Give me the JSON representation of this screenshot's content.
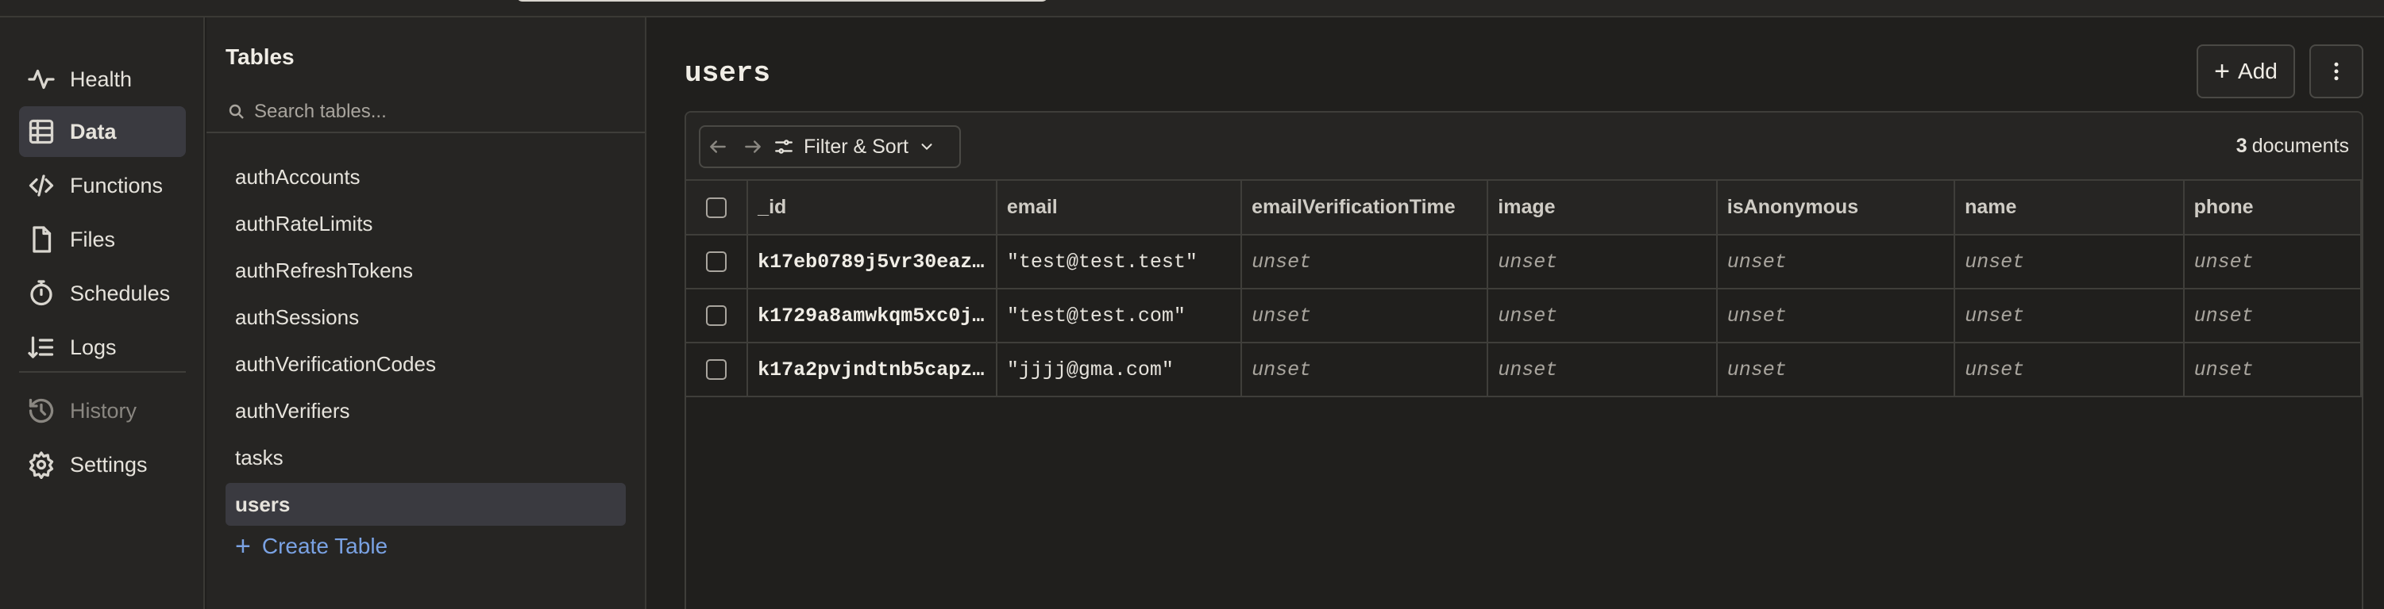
{
  "nav": {
    "items": [
      {
        "label": "Health",
        "icon": "pulse-icon"
      },
      {
        "label": "Data",
        "icon": "table-icon"
      },
      {
        "label": "Functions",
        "icon": "code-icon"
      },
      {
        "label": "Files",
        "icon": "file-icon"
      },
      {
        "label": "Schedules",
        "icon": "stopwatch-icon"
      },
      {
        "label": "Logs",
        "icon": "sort-list-icon"
      },
      {
        "label": "History",
        "icon": "history-icon"
      },
      {
        "label": "Settings",
        "icon": "gear-icon"
      }
    ],
    "active": "Data"
  },
  "tables_panel": {
    "title": "Tables",
    "search_placeholder": "Search tables...",
    "items": [
      "authAccounts",
      "authRateLimits",
      "authRefreshTokens",
      "authSessions",
      "authVerificationCodes",
      "authVerifiers",
      "tasks",
      "users"
    ],
    "active": "users",
    "create_label": "Create Table"
  },
  "main": {
    "title": "users",
    "add_label": "Add",
    "filter_label": "Filter & Sort",
    "doc_count": "3",
    "doc_count_suffix": "documents",
    "columns": [
      "_id",
      "email",
      "emailVerificationTime",
      "image",
      "isAnonymous",
      "name",
      "phone"
    ],
    "rows": [
      [
        "k17eb0789j5vr30eaz…",
        "\"test@test.test\"",
        "unset",
        "unset",
        "unset",
        "unset",
        "unset"
      ],
      [
        "k1729a8amwkqm5xc0j…",
        "\"test@test.com\"",
        "unset",
        "unset",
        "unset",
        "unset",
        "unset"
      ],
      [
        "k17a2pvjndtnb5capz…",
        "\"jjjj@gma.com\"",
        "unset",
        "unset",
        "unset",
        "unset",
        "unset"
      ]
    ]
  },
  "colors": {
    "background": "#201f1d",
    "panel": "#262523",
    "active_item": "#3a3a40",
    "link": "#7aa2e3"
  }
}
